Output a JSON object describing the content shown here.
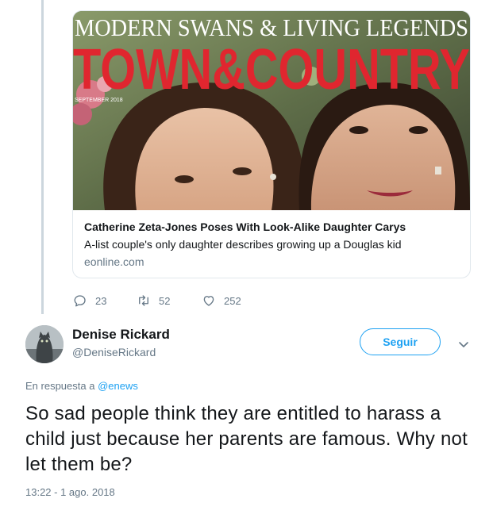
{
  "card": {
    "image": {
      "tagline": "MODERN SWANS & LIVING LEGENDS",
      "masthead": "TOWN&COUNTRY",
      "issue": "SEPTEMBER 2018"
    },
    "title": "Catherine Zeta-Jones Poses With Look-Alike Daughter Carys",
    "description": "A-list couple's only daughter describes growing up a Douglas kid",
    "domain": "eonline.com"
  },
  "actions": {
    "reply_count": "23",
    "retweet_count": "52",
    "like_count": "252",
    "icons": [
      "reply-icon",
      "retweet-icon",
      "heart-icon"
    ]
  },
  "reply": {
    "user": {
      "name": "Denise Rickard",
      "handle": "@DeniseRickard"
    },
    "follow_label": "Seguir",
    "in_reply_prefix": "En respuesta a",
    "in_reply_handle": "@enews",
    "text": "So sad people think they are entitled to harass a child just because her parents are famous. Why not let them be?",
    "timestamp": "13:22 - 1 ago. 2018"
  },
  "colors": {
    "accent": "#1da1f2",
    "secondary_text": "#657786",
    "thread_line": "#ccd6dd",
    "masthead_red": "#e0262f"
  }
}
